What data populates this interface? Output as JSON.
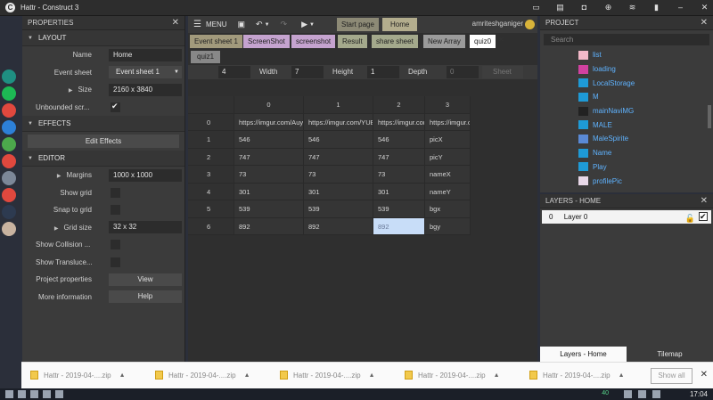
{
  "window": {
    "title": "Hattr - Construct 3",
    "app_icon": "construct-icon"
  },
  "tray": [
    "window-icon",
    "clipboard-icon",
    "lock-icon",
    "zoom-icon",
    "wifi-icon",
    "battery-icon",
    "minimize-icon",
    "close-icon"
  ],
  "dock": [
    {
      "icon": "settings-icon",
      "color": "#1f8f82"
    },
    {
      "icon": "spotify-icon",
      "color": "#1db954"
    },
    {
      "icon": "chrome-icon",
      "color": "#e0483e"
    },
    {
      "icon": "files-icon",
      "color": "#2d80d8"
    },
    {
      "icon": "leaf-icon",
      "color": "#4ca84c"
    },
    {
      "icon": "chrome-icon",
      "color": "#e0483e"
    },
    {
      "icon": "monitor-icon",
      "color": "#7c8798"
    },
    {
      "icon": "chrome-icon",
      "color": "#e0483e"
    },
    {
      "icon": "construct-icon",
      "color": "#2d3a50"
    },
    {
      "icon": "installer-icon",
      "color": "#c8b3a0"
    }
  ],
  "properties": {
    "header": "PROPERTIES",
    "layout_section": "LAYOUT",
    "name_label": "Name",
    "name_value": "Home",
    "event_sheet_label": "Event sheet",
    "event_sheet_value": "Event sheet 1",
    "size_label": "Size",
    "size_value": "2160 x 3840",
    "unbounded_label": "Unbounded scr...",
    "effects_section": "EFFECTS",
    "edit_effects": "Edit Effects",
    "editor_section": "EDITOR",
    "margins_label": "Margins",
    "margins_value": "1000 x 1000",
    "show_grid_label": "Show grid",
    "snap_grid_label": "Snap to grid",
    "grid_size_label": "Grid size",
    "grid_size_value": "32 x 32",
    "show_collision_label": "Show Collision ...",
    "show_translucent_label": "Show Transluce...",
    "project_props_label": "Project properties",
    "project_props_btn": "View",
    "more_info_label": "More information",
    "more_info_btn": "Help"
  },
  "toolbar": {
    "menu": "MENU",
    "start_page": "Start page",
    "home": "Home",
    "user": "amriteshganiger"
  },
  "doc_tabs": [
    {
      "label": "Event sheet 1",
      "color": "#a29a7c"
    },
    {
      "label": "ScreenShot",
      "color": "#c5a3cf"
    },
    {
      "label": "screenshot",
      "color": "#c5a3cf"
    },
    {
      "label": "Result",
      "color": "#a4a98c"
    },
    {
      "label": "share sheet",
      "color": "#a4a98c"
    },
    {
      "label": "New Array",
      "color": "#9b9b9b"
    },
    {
      "label": "quiz0",
      "color": "#ffffff"
    }
  ],
  "doc_tabs_row2": [
    "quiz1"
  ],
  "array_dims": {
    "width_label": "Width",
    "height_label": "Height",
    "depth_label": "Depth",
    "x_value": "4",
    "width_value": "7",
    "height_value": "1",
    "depth_value": "0",
    "sheet_label": "Sheet"
  },
  "grid": {
    "columns": [
      "0",
      "1",
      "2",
      "3"
    ],
    "rows": [
      {
        "index": "0",
        "cells": [
          "https://imgur.com/Auy",
          "https://imgur.com/YUE",
          "https://imgur.com",
          "https://imgur.c"
        ]
      },
      {
        "index": "1",
        "cells": [
          "546",
          "546",
          "546",
          "picX"
        ]
      },
      {
        "index": "2",
        "cells": [
          "747",
          "747",
          "747",
          "picY"
        ]
      },
      {
        "index": "3",
        "cells": [
          "73",
          "73",
          "73",
          "nameX"
        ]
      },
      {
        "index": "4",
        "cells": [
          "301",
          "301",
          "301",
          "nameY"
        ]
      },
      {
        "index": "5",
        "cells": [
          "539",
          "539",
          "539",
          "bgx"
        ]
      },
      {
        "index": "6",
        "cells": [
          "892",
          "892",
          "892",
          "bgy"
        ]
      }
    ]
  },
  "project": {
    "header": "PROJECT",
    "search_placeholder": "Search",
    "items": [
      {
        "label": "list",
        "color": "#f2b8c8"
      },
      {
        "label": "loading",
        "color": "#d041a0"
      },
      {
        "label": "LocalStorage",
        "color": "#1e9ad6"
      },
      {
        "label": "M",
        "color": "#1e9ad6"
      },
      {
        "label": "mainNaviMG",
        "color": "#222222"
      },
      {
        "label": "MALE",
        "color": "#1e9ad6"
      },
      {
        "label": "MaleSpirite",
        "color": "#5a8ad6"
      },
      {
        "label": "Name",
        "color": "#1e9ad6"
      },
      {
        "label": "Play",
        "color": "#1e9ad6"
      },
      {
        "label": "profilePic",
        "color": "#e8d8e8"
      }
    ]
  },
  "layers": {
    "header": "LAYERS - HOME",
    "items": [
      {
        "index": "0",
        "name": "Layer 0"
      }
    ],
    "tab_layers": "Layers - Home",
    "tab_tilemap": "Tilemap"
  },
  "downloads": {
    "items": [
      "Hattr - 2019-04-....zip",
      "Hattr - 2019-04-....zip",
      "Hattr - 2019-04-....zip",
      "Hattr - 2019-04-....zip",
      "Hattr - 2019-04-....zip"
    ],
    "show_all": "Show all"
  },
  "taskbar": {
    "clock": "17:04",
    "badge": "40"
  }
}
